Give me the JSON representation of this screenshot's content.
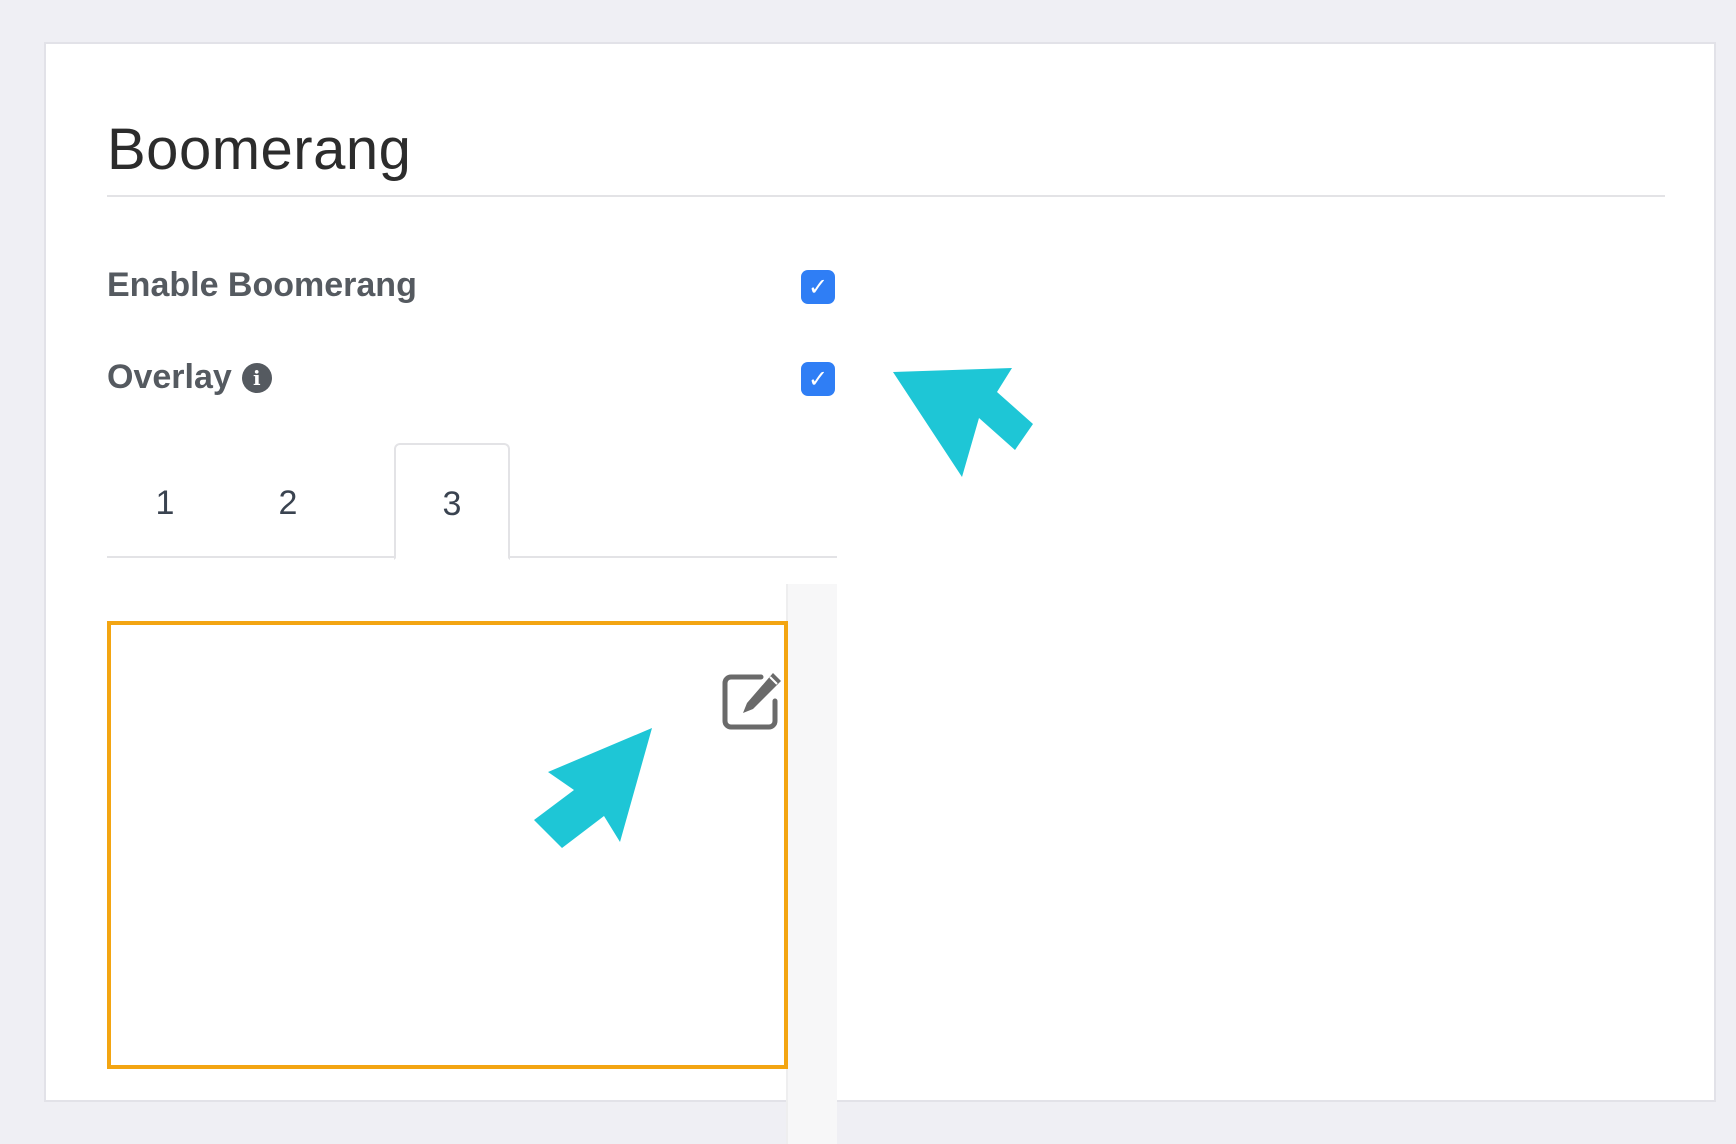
{
  "section": {
    "title": "Boomerang"
  },
  "fields": {
    "enable": {
      "label": "Enable Boomerang",
      "checked": true
    },
    "overlay": {
      "label": "Overlay",
      "checked": true,
      "info_icon": "info-circle-icon"
    }
  },
  "tabs": [
    {
      "label": "1",
      "active": false
    },
    {
      "label": "2",
      "active": false
    },
    {
      "label": "3",
      "active": true
    }
  ],
  "slide": {
    "edit_icon": "edit-pencil-icon"
  },
  "colors": {
    "accent_checkbox": "#2f7ef5",
    "slide_border": "#f3a512",
    "annotation_arrow": "#1ec6d6"
  },
  "checkmark_glyph": "✓"
}
